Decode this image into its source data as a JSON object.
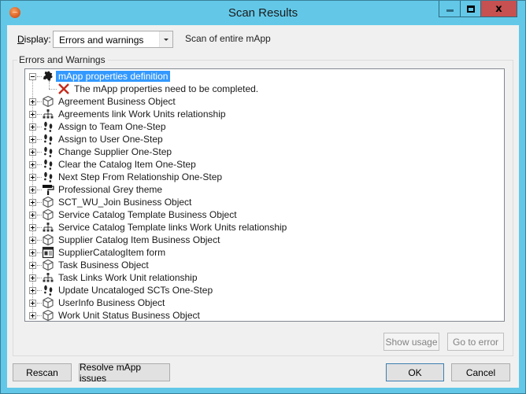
{
  "window": {
    "title": "Scan Results",
    "controls": {
      "minimize": "minimize",
      "maximize": "maximize",
      "close": "x"
    }
  },
  "toolbar": {
    "display_label_prefix": "D",
    "display_label_rest": "isplay:",
    "display_value": "Errors and warnings",
    "scan_scope": "Scan of entire mApp"
  },
  "group": {
    "title": "Errors and Warnings"
  },
  "tree": {
    "items": [
      {
        "label": "mApp properties definition",
        "icon": "puzzle-icon",
        "expanded": true,
        "selected": true,
        "children": [
          {
            "label": "The mApp properties need to be completed.",
            "icon": "error-x-icon"
          }
        ]
      },
      {
        "label": "Agreement Business Object",
        "icon": "cube-icon"
      },
      {
        "label": "Agreements link Work Units relationship",
        "icon": "relationship-icon"
      },
      {
        "label": "Assign to Team One-Step",
        "icon": "footsteps-icon"
      },
      {
        "label": "Assign to User One-Step",
        "icon": "footsteps-icon"
      },
      {
        "label": "Change Supplier One-Step",
        "icon": "footsteps-icon"
      },
      {
        "label": "Clear the Catalog Item One-Step",
        "icon": "footsteps-icon"
      },
      {
        "label": "Next Step From Relationship One-Step",
        "icon": "footsteps-icon"
      },
      {
        "label": "Professional Grey theme",
        "icon": "paint-roller-icon"
      },
      {
        "label": "SCT_WU_Join Business Object",
        "icon": "cube-icon"
      },
      {
        "label": "Service Catalog Template Business Object",
        "icon": "cube-icon"
      },
      {
        "label": "Service Catalog Template links Work Units relationship",
        "icon": "relationship-icon"
      },
      {
        "label": "Supplier Catalog Item Business Object",
        "icon": "cube-icon"
      },
      {
        "label": "SupplierCatalogItem form",
        "icon": "form-icon"
      },
      {
        "label": "Task Business Object",
        "icon": "cube-icon"
      },
      {
        "label": "Task Links Work Unit relationship",
        "icon": "relationship-icon"
      },
      {
        "label": "Update Uncataloged SCTs One-Step",
        "icon": "footsteps-icon"
      },
      {
        "label": "UserInfo Business Object",
        "icon": "cube-icon"
      },
      {
        "label": "Work Unit Status Business Object",
        "icon": "cube-icon"
      }
    ]
  },
  "buttons": {
    "show_usage": "Show usage",
    "go_to_error": "Go to error",
    "rescan": "Rescan",
    "resolve": "Resolve mApp issues",
    "ok": "OK",
    "cancel": "Cancel"
  },
  "colors": {
    "titlebar": "#63c8e8",
    "close_button": "#c75050",
    "selection": "#3399ff",
    "error": "#c42b1c"
  }
}
